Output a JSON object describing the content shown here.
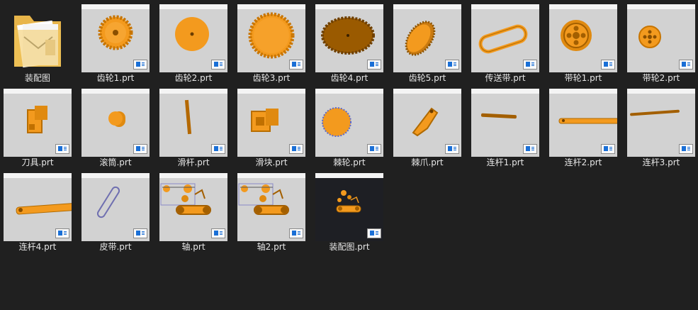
{
  "files": [
    {
      "label": "装配图",
      "icon": "folder-icon"
    },
    {
      "label": "齿轮1.prt"
    },
    {
      "label": "齿轮2.prt"
    },
    {
      "label": "齿轮3.prt"
    },
    {
      "label": "齿轮4.prt"
    },
    {
      "label": "齿轮5.prt"
    },
    {
      "label": "传送带.prt"
    },
    {
      "label": "带轮1.prt"
    },
    {
      "label": "带轮2.prt"
    },
    {
      "label": "刀具.prt"
    },
    {
      "label": "滚筒.prt"
    },
    {
      "label": "滑杆.prt"
    },
    {
      "label": "滑块.prt"
    },
    {
      "label": "棘轮.prt"
    },
    {
      "label": "棘爪.prt"
    },
    {
      "label": "连杆1.prt"
    },
    {
      "label": "连杆2.prt"
    },
    {
      "label": "连杆3.prt"
    },
    {
      "label": "连杆4.prt"
    },
    {
      "label": "皮带.prt"
    },
    {
      "label": "轴.prt"
    },
    {
      "label": "轴2.prt"
    },
    {
      "label": "装配图.prt"
    }
  ],
  "colors": {
    "background": "#202020",
    "thumb": "#d2d2d2",
    "part": "#f39a1e",
    "part_dark": "#9a5a00",
    "badge": "#1a6fd6"
  }
}
